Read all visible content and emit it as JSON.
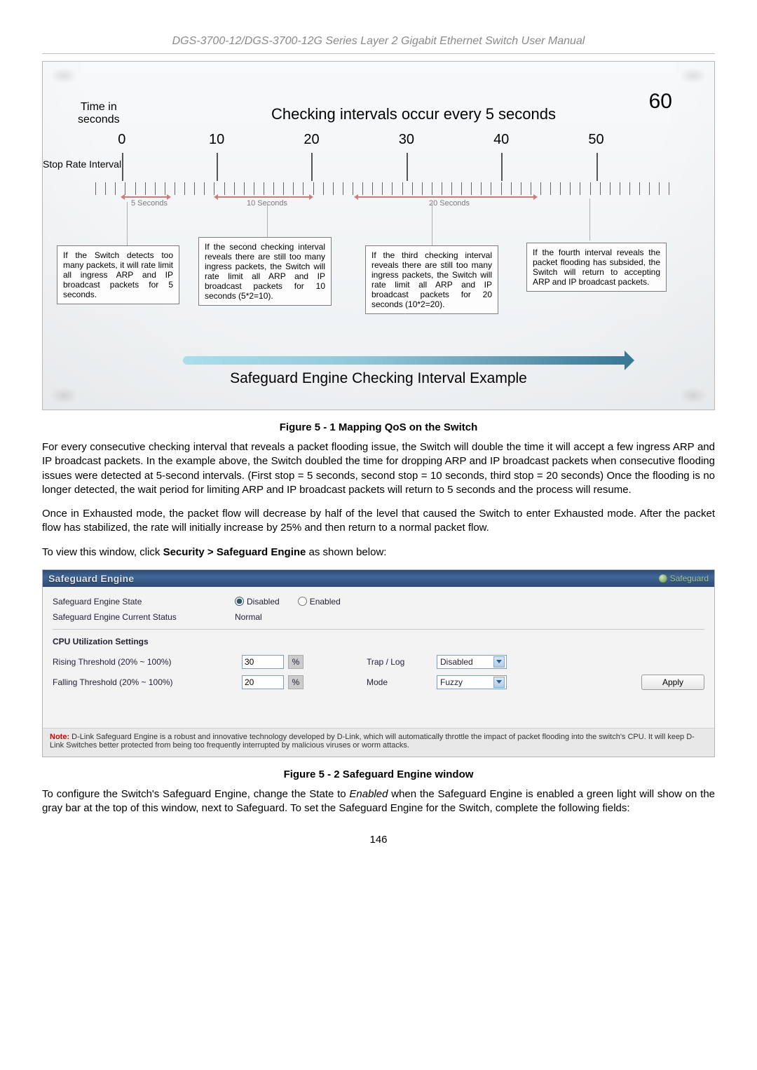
{
  "doc_header": "DGS-3700-12/DGS-3700-12G Series Layer 2 Gigabit Ethernet Switch User Manual",
  "chart_data": {
    "type": "bar",
    "title": "Checking intervals occur every 5 seconds",
    "subtitle": "Safeguard Engine Checking Interval Example",
    "xlabel": "Time in seconds",
    "ylabel": "",
    "categories": [
      0,
      10,
      20,
      30,
      40,
      50,
      60
    ],
    "x": [
      0,
      10,
      20,
      30,
      40,
      50,
      60
    ],
    "series": [
      {
        "name": "Stop Rate Interval (sec)",
        "values": [
          5,
          10,
          20
        ]
      }
    ],
    "annotations": [
      "If the Switch detects too many packets, it will rate limit all ingress ARP and IP broadcast packets for 5 seconds.",
      "If the second checking interval reveals there are still too many ingress packets, the Switch will rate limit all ARP and IP broadcast packets for 10 seconds (5*2=10).",
      "If the third checking interval reveals there are still too many ingress packets, the Switch will rate limit all ARP and IP broadcast packets for 20 seconds (10*2=20).",
      "If the fourth interval reveals the packet flooding has subsided, the Switch will return to accepting ARP and IP broadcast packets."
    ],
    "segments_labels": [
      "5 Seconds",
      "10 Seconds",
      "20 Seconds"
    ],
    "stop_rate_label": "Stop Rate Interval",
    "time_label_l1": "Time in",
    "time_label_l2": "seconds",
    "sixty": "60"
  },
  "figure1_caption": "Figure 5 - 1 Mapping QoS on the Switch",
  "para1": "For every consecutive checking interval that reveals a packet flooding issue, the Switch will double the time it will accept a few ingress ARP and IP broadcast packets. In the example above, the Switch doubled the time for dropping ARP and IP broadcast packets when consecutive flooding issues were detected at 5-second intervals. (First stop = 5 seconds, second stop = 10 seconds, third stop = 20 seconds) Once the flooding is no longer detected, the wait period for limiting ARP and IP broadcast packets will return to 5 seconds and the process will resume.",
  "para2": "Once in Exhausted mode, the packet flow will decrease by half of the level that caused the Switch to enter Exhausted mode. After the packet flow has stabilized, the rate will initially increase by 25% and then return to a normal packet flow.",
  "para3_pre": "To view this window, click ",
  "para3_bold": "Security > Safeguard Engine",
  "para3_post": " as shown below:",
  "panel": {
    "title": "Safeguard Engine",
    "badge": "Safeguard",
    "row1_label": "Safeguard Engine State",
    "radio_disabled": "Disabled",
    "radio_enabled": "Enabled",
    "row2_label": "Safeguard Engine Current Status",
    "row2_value": "Normal",
    "section": "CPU Utilization Settings",
    "rising_label": "Rising Threshold (20% ~ 100%)",
    "rising_value": "30",
    "falling_label": "Falling Threshold (20% ~ 100%)",
    "falling_value": "20",
    "pct": "%",
    "traplog_label": "Trap / Log",
    "traplog_value": "Disabled",
    "mode_label": "Mode",
    "mode_value": "Fuzzy",
    "apply": "Apply",
    "note_prefix": "Note:",
    "note_text": " D-Link Safeguard Engine is a robust and innovative technology developed by D-Link, which will automatically throttle the impact of packet flooding into the switch's CPU. It will keep D-Link Switches better protected from being too frequently interrupted by malicious viruses or worm attacks."
  },
  "figure2_caption": "Figure 5 - 2 Safeguard Engine window",
  "para4_pre": "To configure the Switch's Safeguard Engine, change the State to ",
  "para4_italic": "Enabled",
  "para4_post": " when the Safeguard Engine is enabled a green light will show on the gray bar at the top of this window, next to Safeguard. To set the Safeguard Engine for the Switch, complete the following fields:",
  "page_number": "146"
}
